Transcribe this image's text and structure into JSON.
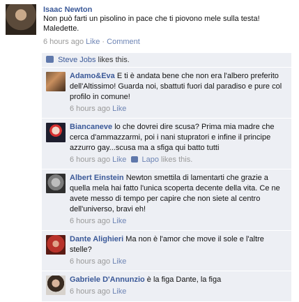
{
  "post": {
    "author": "Isaac Newton",
    "message": "Non può farti un pisolino in pace che ti piovono mele sulla testa! Maledette.",
    "time": "6 hours ago",
    "like_label": "Like",
    "comment_label": "Comment"
  },
  "likes": {
    "name": "Steve Jobs",
    "suffix": "likes this."
  },
  "comments": [
    {
      "author": "Adamo&Eva",
      "text": "E ti è andata bene che non era l'albero preferito dell'Altissimo! Guarda noi, sbattuti fuori dal paradiso e pure col profilo in comune!",
      "time": "6 hours ago",
      "like_label": "Like"
    },
    {
      "author": "Biancaneve",
      "text": "lo che dovrei dire scusa? Prima mia madre che cerca d'ammazzarmi, poi i nani stupratori e infine il principe azzurro gay...scusa ma a sfiga qui batto tutti",
      "time": "6 hours ago",
      "like_label": "Like",
      "liker": "Lapo",
      "liker_suffix": "likes this."
    },
    {
      "author": "Albert Einstein",
      "text": "Newton smettila di lamentarti che grazie a quella mela hai fatto l'unica scoperta decente della vita. Ce ne avete messo di tempo per capire che non siete al centro dell'universo, bravi eh!",
      "time": "6 hours ago",
      "like_label": "Like"
    },
    {
      "author": "Dante Alighieri",
      "text": "Ma non è l'amor che move il sole e l'altre stelle?",
      "time": "6 hours ago",
      "like_label": "Like"
    },
    {
      "author": "Gabriele D'Annunzio",
      "text": "è la figa Dante, la figa",
      "time": "6 hours ago",
      "like_label": "Like"
    }
  ]
}
